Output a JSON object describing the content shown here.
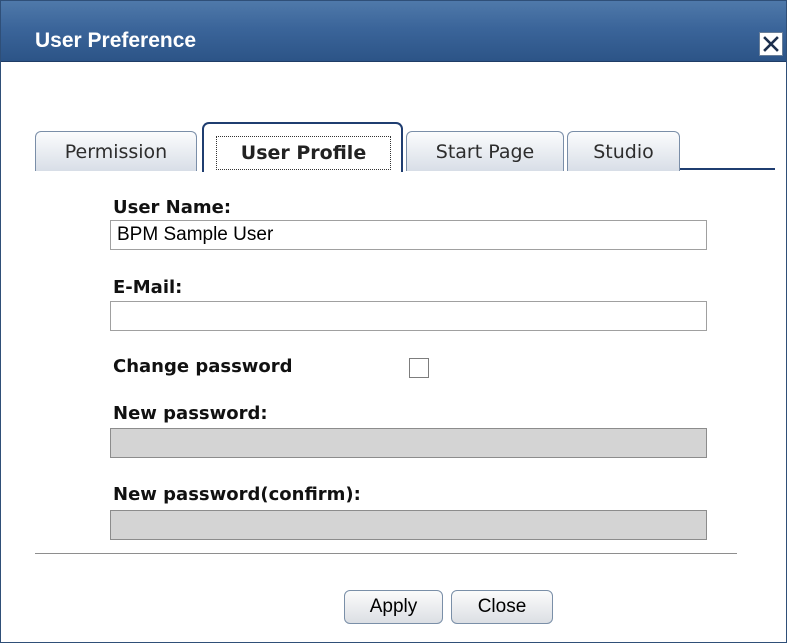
{
  "window": {
    "title": "User Preference"
  },
  "tabs": [
    {
      "label": "Permission",
      "active": false
    },
    {
      "label": "User Profile",
      "active": true
    },
    {
      "label": "Start Page",
      "active": false
    },
    {
      "label": "Studio",
      "active": false
    }
  ],
  "form": {
    "user_name": {
      "label": "User Name:",
      "value": "BPM Sample User"
    },
    "email": {
      "label": "E-Mail:",
      "value": ""
    },
    "change_password": {
      "label": "Change password",
      "checked": false
    },
    "new_password": {
      "label": "New password:",
      "value": ""
    },
    "confirm_password": {
      "label": "New password(confirm):",
      "value": ""
    }
  },
  "buttons": {
    "apply": "Apply",
    "close": "Close"
  },
  "icons": {
    "close": "close-icon"
  },
  "colors": {
    "titlebar": "#3b659a",
    "tab_accent": "#1f3d70",
    "disabled_field": "#d4d4d4"
  }
}
